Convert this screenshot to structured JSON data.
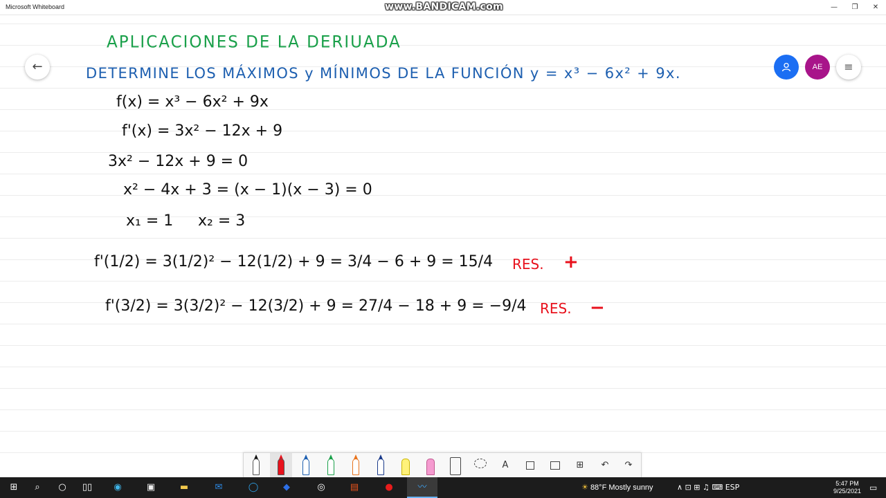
{
  "window": {
    "title": "Microsoft Whiteboard",
    "watermark": "www.BANDICAM.com",
    "minimize": "—",
    "restore": "❐",
    "close": "✕"
  },
  "board": {
    "back": "←",
    "share_glyph": "👤",
    "avatar": "AE",
    "menu": "≡",
    "heading": "APLICACIONES DE LA DERIUADA",
    "task": "DETERMINE LOS MÁXIMOS y MÍNIMOS DE LA FUNCIÓN y = x³ − 6x² + 9x.",
    "lines": {
      "l1": "f(x) = x³ − 6x² + 9x",
      "l2": "f'(x) = 3x² − 12x + 9",
      "l3": "3x² − 12x + 9 = 0",
      "l4": "x² − 4x + 3 = (x − 1)(x − 3) = 0",
      "l5a": "x₁ = 1",
      "l5b": "x₂ = 3",
      "l6": "f'(1/2) = 3(1/2)² − 12(1/2) + 9 = 3/4 − 6 + 9 = 15/4",
      "l7": "f'(3/2) = 3(3/2)² − 12(3/2) + 9 = 27/4 − 18 + 9 = −9/4"
    },
    "res1_label": "RES.",
    "res1_sign": "+",
    "res2_label": "RES.",
    "res2_sign": "−"
  },
  "toolbar": {
    "tools": [
      "pen-black",
      "pen-red",
      "pen-blue",
      "pen-green",
      "pen-orange",
      "pen-darkblue",
      "highlighter-yellow",
      "highlighter-pink",
      "ruler",
      "lasso",
      "text",
      "sticky-note",
      "image",
      "add",
      "undo",
      "redo"
    ],
    "text_glyph": "A",
    "add_glyph": "⊞",
    "undo_glyph": "↶",
    "redo_glyph": "↷"
  },
  "taskbar": {
    "start": "⊞",
    "search": "⌕",
    "cortana": "○",
    "weather_temp": "88°F",
    "weather_text": "Mostly sunny",
    "tray": "∧  ⊡  ⊞  ♫  ⌨  ESP",
    "time": "5:47 PM",
    "date": "9/25/2021",
    "notifications": "▭"
  },
  "colors": {
    "heading_green": "#1aa04a",
    "task_blue": "#1d5fb0",
    "res_red": "#e8111c",
    "share_blue": "#1b6ef3",
    "avatar_purple": "#a8148a",
    "taskbar_bg": "#1c1c1c"
  }
}
